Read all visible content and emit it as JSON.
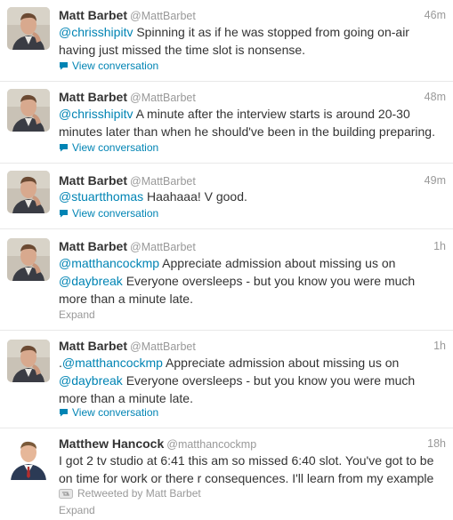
{
  "tweets": [
    {
      "name": "Matt Barbet",
      "handle": "@MattBarbet",
      "time": "46m",
      "mention": "@chrisshipitv",
      "text": " Spinning it as if he was stopped from going on-air having just missed the time slot is nonsense.",
      "action": "View conversation",
      "action_icon": "conversation-bubble-icon"
    },
    {
      "name": "Matt Barbet",
      "handle": "@MattBarbet",
      "time": "48m",
      "mention": "@chrisshipitv",
      "text": " A minute after the interview starts is around 20-30 minutes later than when he should've been in the building preparing.",
      "action": "View conversation",
      "action_icon": "conversation-bubble-icon"
    },
    {
      "name": "Matt Barbet",
      "handle": "@MattBarbet",
      "time": "49m",
      "mention": "@stuartthomas",
      "text": " Haahaaa! V good.",
      "action": "View conversation",
      "action_icon": "conversation-bubble-icon"
    },
    {
      "name": "Matt Barbet",
      "handle": "@MattBarbet",
      "time": "1h",
      "mention": "@matthancockmp",
      "text_a": " Appreciate admission about missing us on ",
      "mention2": "@daybreak",
      "text_b": " Everyone oversleeps - but you know you were much more than a minute late.",
      "action": "Expand"
    },
    {
      "name": "Matt Barbet",
      "handle": "@MattBarbet",
      "time": "1h",
      "prefix": ".",
      "mention": "@matthancockmp",
      "text_a": " Appreciate admission about missing us on ",
      "mention2": "@daybreak",
      "text_b": " Everyone oversleeps - but you know you were much more than a minute late.",
      "action": "View conversation",
      "action_icon": "conversation-bubble-icon"
    },
    {
      "name": "Matthew Hancock",
      "handle": "@matthancockmp",
      "time": "18h",
      "text": "I got 2 tv studio at 6:41 this am so missed 6:40 slot. You've got to be on time for work or there r consequences. I'll learn from my example",
      "retweeted_by": "Retweeted by Matt Barbet",
      "retweet_icon": "retweet-icon",
      "action": "Expand"
    }
  ],
  "colors": {
    "link": "#0084b4",
    "muted": "#999999",
    "text": "#333333"
  }
}
